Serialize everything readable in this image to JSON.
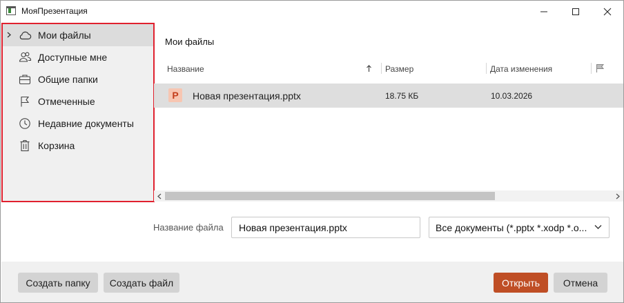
{
  "window": {
    "title": "МояПрезентация"
  },
  "sidebar": {
    "items": [
      {
        "label": "Мои файлы",
        "icon": "cloud-icon",
        "active": true
      },
      {
        "label": "Доступные мне",
        "icon": "users-icon"
      },
      {
        "label": "Общие папки",
        "icon": "briefcase-icon"
      },
      {
        "label": "Отмеченные",
        "icon": "flag-icon"
      },
      {
        "label": "Недавние документы",
        "icon": "clock-icon"
      },
      {
        "label": "Корзина",
        "icon": "trash-icon"
      }
    ]
  },
  "main": {
    "title": "Мои файлы",
    "columns": {
      "name": "Название",
      "size": "Размер",
      "date": "Дата изменения"
    },
    "files": [
      {
        "icon_letter": "P",
        "name": "Новая презентация.pptx",
        "size": "18.75 КБ",
        "date": "10.03.2026"
      }
    ]
  },
  "filename": {
    "label": "Название файла",
    "value": "Новая презентация.pptx"
  },
  "filetype": {
    "selected": "Все документы (*.pptx *.xodp *.o..."
  },
  "footer": {
    "create_folder": "Создать папку",
    "create_file": "Создать файл",
    "open": "Открыть",
    "cancel": "Отмена"
  },
  "colors": {
    "accent": "#bf4e25",
    "highlight_border": "#e0202e",
    "ppt_icon_bg": "#f7c6b2",
    "ppt_icon_fg": "#c43e1c"
  }
}
